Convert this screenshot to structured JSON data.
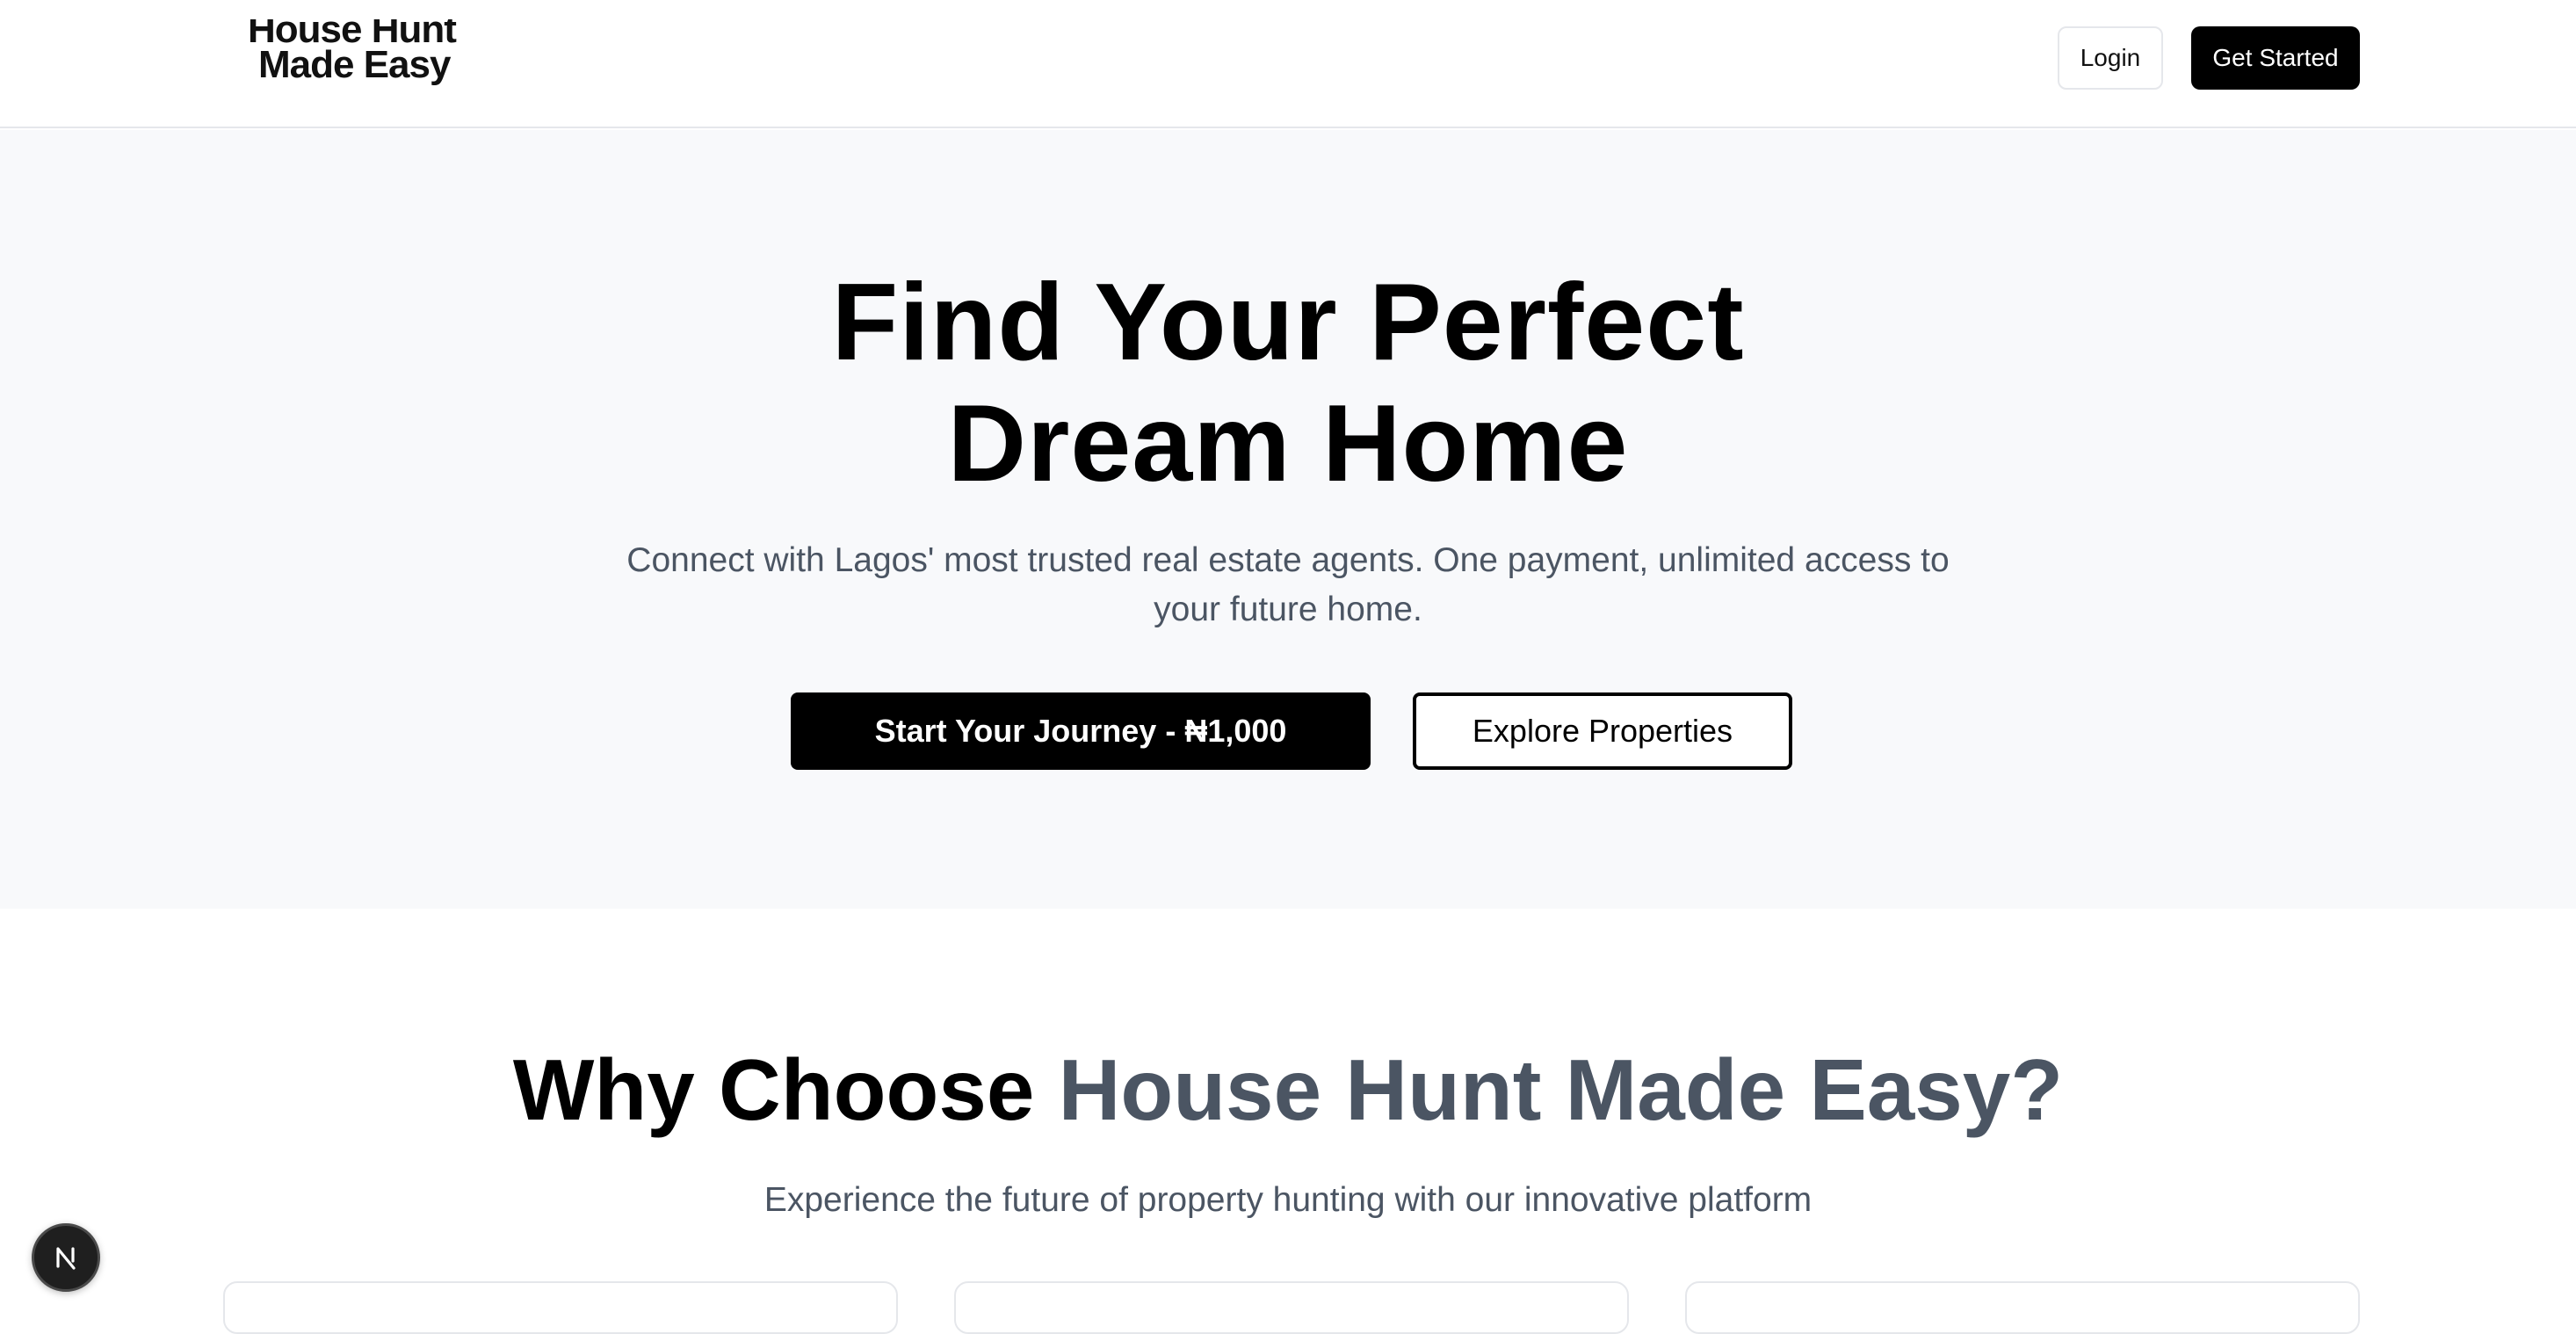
{
  "header": {
    "logo_line1": "House Hunt",
    "logo_line2": "Made Easy",
    "login_label": "Login",
    "get_started_label": "Get Started"
  },
  "hero": {
    "title_line1": "Find Your Perfect",
    "title_line2": "Dream Home",
    "subtitle": "Connect with Lagos' most trusted real estate agents. One payment, unlimited access to your future home.",
    "primary_button": "Start Your Journey - ₦1,000",
    "secondary_button": "Explore Properties"
  },
  "why": {
    "title_prefix": "Why Choose ",
    "title_accent": "House Hunt Made Easy?",
    "subtitle": "Experience the future of property hunting with our innovative platform"
  },
  "dev_badge": {
    "icon": "nextjs-n-icon"
  },
  "colors": {
    "primary": "#000000",
    "accent_text": "#4b5563",
    "hero_bg": "#f8f9fb",
    "border": "#e5e7eb"
  }
}
